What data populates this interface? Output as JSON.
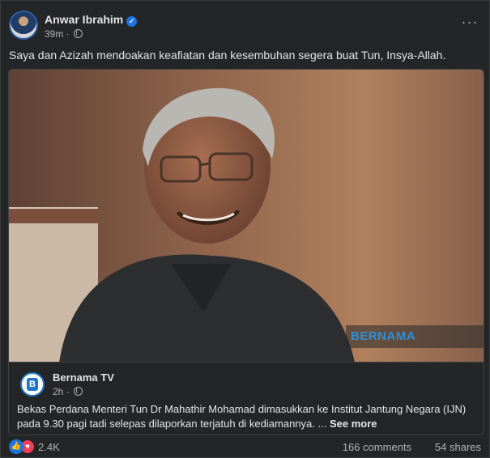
{
  "post": {
    "author": "Anwar Ibrahim",
    "timestamp": "39m",
    "caption": "Saya dan Azizah mendoakan keafiatan dan kesembuhan segera buat Tun, Insya-Allah.",
    "more_icon": "more-dots-icon",
    "verified_icon": "verified-badge-icon",
    "audience_icon": "globe-icon"
  },
  "shared": {
    "watermark": "BERNAMA",
    "page_name": "Bernama TV",
    "timestamp": "2h",
    "text": "Bekas Perdana Menteri Tun Dr Mahathir Mohamad dimasukkan ke Institut Jantung Negara (IJN) pada 9.30 pagi tadi selepas dilaporkan terjatuh di kediamannya. ...",
    "see_more": "See more",
    "avatar_mark": "B"
  },
  "footer": {
    "reactions": "2.4K",
    "comments": "166 comments",
    "shares": "54 shares"
  },
  "colors": {
    "background": "#242526",
    "text": "#e4e6eb",
    "secondary": "#b0b3b8",
    "like": "#1b74e4",
    "love": "#f33e58",
    "bernama": "#2d8fd6"
  }
}
